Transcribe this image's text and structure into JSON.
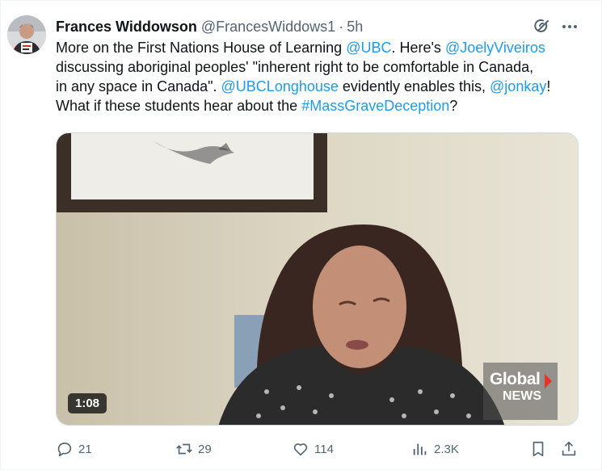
{
  "tweet": {
    "author_name": "Frances Widdowson",
    "handle": "@FrancesWiddows1",
    "separator": "·",
    "time": "5h",
    "text": [
      [
        {
          "t": "More on the First Nations House of Learning "
        },
        {
          "t": "@UBC",
          "link": true
        },
        {
          "t": ". Here's "
        },
        {
          "t": "@JoelyViveiros",
          "link": true
        }
      ],
      [
        {
          "t": "discussing aboriginal peoples' \"inherent right to be comfortable in Canada,"
        }
      ],
      [
        {
          "t": "in any space in Canada\".  "
        },
        {
          "t": "@UBCLonghouse",
          "link": true
        },
        {
          "t": " evidently enables this, "
        },
        {
          "t": "@jonkay",
          "link": true
        },
        {
          "t": "!"
        }
      ],
      [
        {
          "t": "What if these students hear about the "
        },
        {
          "t": "#MassGraveDeception",
          "link": true
        },
        {
          "t": "?"
        }
      ]
    ]
  },
  "media": {
    "duration": "1:08",
    "watermark_top": "Global",
    "watermark_bottom": "NEWS",
    "watermark_accent": "#e8352b"
  },
  "actions": {
    "replies": "21",
    "reposts": "29",
    "likes": "114",
    "views": "2.3K"
  },
  "colors": {
    "link": "#1d9bf0",
    "secondary": "#536471",
    "text": "#0f1419"
  },
  "icons": {
    "reply": "reply-icon",
    "repost": "repost-icon",
    "like": "heart-icon",
    "views": "views-icon",
    "bookmark": "bookmark-icon",
    "share": "share-icon",
    "grok": "grok-icon",
    "more": "more-icon"
  }
}
